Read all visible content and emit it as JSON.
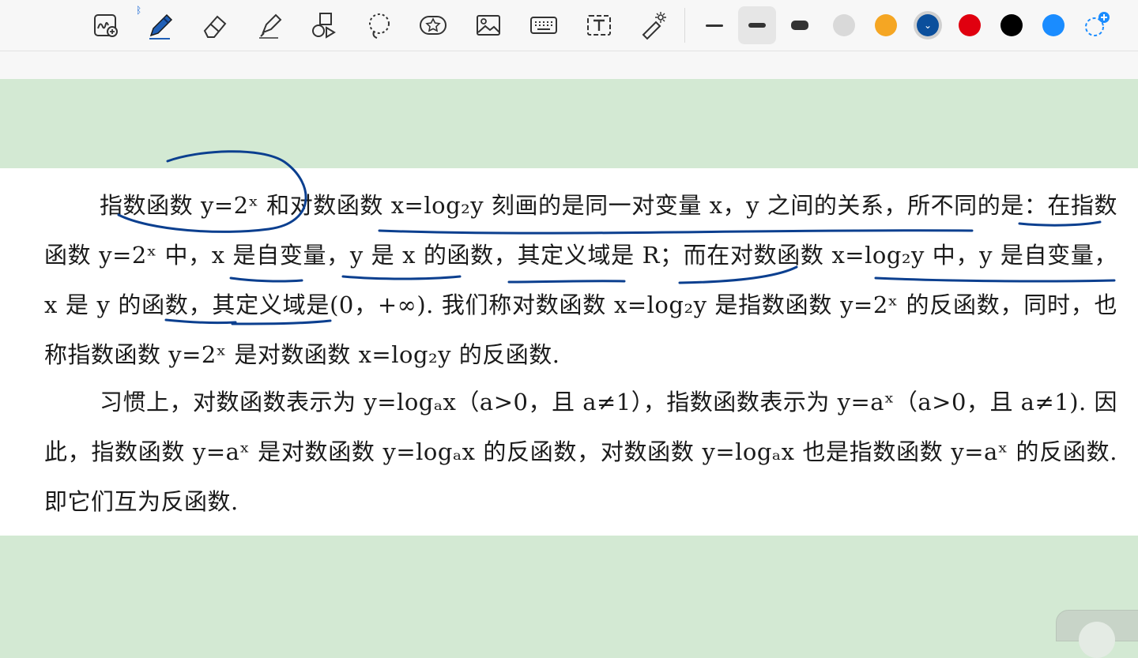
{
  "toolbar": {
    "tools": [
      {
        "name": "handwriting-to-text",
        "icon": "handwriting-zoom-icon"
      },
      {
        "name": "pen",
        "icon": "pen-icon",
        "selected": true,
        "badge": "bluetooth-icon"
      },
      {
        "name": "eraser",
        "icon": "eraser-icon"
      },
      {
        "name": "highlighter",
        "icon": "highlighter-icon"
      },
      {
        "name": "shapes",
        "icon": "shapes-icon"
      },
      {
        "name": "lasso",
        "icon": "lasso-icon"
      },
      {
        "name": "sticker",
        "icon": "sticker-star-icon"
      },
      {
        "name": "image",
        "icon": "image-icon"
      },
      {
        "name": "keyboard",
        "icon": "keyboard-icon"
      },
      {
        "name": "text-box",
        "icon": "text-box-icon"
      },
      {
        "name": "laser-pointer",
        "icon": "laser-pointer-icon"
      }
    ],
    "stroke_widths": [
      "thin",
      "medium",
      "thick"
    ],
    "selected_stroke": "medium",
    "colors": [
      "#d9d9d9",
      "#f5a623",
      "#0b4f9c",
      "#e0000f",
      "#000000",
      "#1a8cff"
    ],
    "selected_color": "#0b4f9c",
    "add_color_icon": "add-color-icon"
  },
  "document": {
    "paragraph1": "指数函数 y=2ˣ 和对数函数 x=log₂y 刻画的是同一对变量 x，y 之间的关系，所不同的是：在指数函数 y=2ˣ 中，x 是自变量，y 是 x 的函数，其定义域是 R；而在对数函数 x=log₂y 中，y 是自变量，x 是 y 的函数，其定义域是(0，+∞). 我们称对数函数 x=log₂y 是指数函数 y=2ˣ 的反函数，同时，也称指数函数 y=2ˣ 是对数函数 x=log₂y 的反函数.",
    "paragraph2": "习惯上，对数函数表示为 y=logₐx（a>0，且 a≠1），指数函数表示为 y=aˣ（a>0，且 a≠1). 因此，指数函数 y=aˣ 是对数函数 y=logₐx 的反函数，对数函数 y=logₐx 也是指数函数 y=aˣ 的反函数. 即它们互为反函数.",
    "ink_color": "#0b3f8f"
  }
}
